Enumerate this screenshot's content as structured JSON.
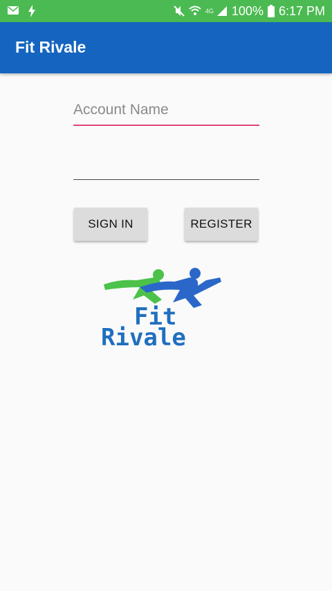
{
  "status_bar": {
    "battery": "100%",
    "time": "6:17 PM",
    "network": "4G",
    "icons": [
      "mail-icon",
      "charging-bolt-icon",
      "mute-icon",
      "wifi-icon",
      "signal-icon",
      "battery-icon"
    ]
  },
  "app_bar": {
    "title": "Fit Rivale"
  },
  "login": {
    "account_placeholder": "Account Name",
    "account_value": "",
    "password_value": "",
    "sign_in_label": "SIGN IN",
    "register_label": "REGISTER"
  },
  "logo": {
    "line1": "Fit",
    "line2": "Rivale",
    "runner_colors": [
      "#4cc24a",
      "#2a67c9"
    ],
    "text_color": "#1f6fbf"
  },
  "colors": {
    "status_bar": "#4cba52",
    "app_bar": "#1565c0",
    "accent_underline": "#e0457b",
    "background": "#fafafa"
  }
}
